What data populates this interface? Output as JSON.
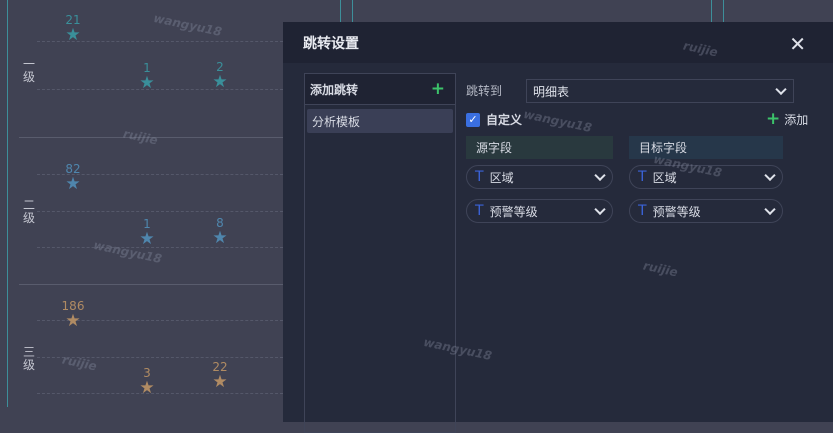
{
  "chart": {
    "rows": [
      {
        "label": "一级",
        "color": "#3a8f9a",
        "points": [
          {
            "value": "21"
          },
          {
            "value": "1"
          },
          {
            "value": "2"
          }
        ]
      },
      {
        "label": "二级",
        "color": "#4f86ad",
        "points": [
          {
            "value": "82"
          },
          {
            "value": "1"
          },
          {
            "value": "8"
          }
        ]
      },
      {
        "label": "三级",
        "color": "#b08b63",
        "points": [
          {
            "value": "186"
          },
          {
            "value": "3"
          },
          {
            "value": "22"
          }
        ]
      }
    ]
  },
  "watermarks": [
    "wangyu18",
    "ruijie"
  ],
  "modal": {
    "title": "跳转设置",
    "left": {
      "header": "添加跳转",
      "items": [
        "分析模板"
      ]
    },
    "jump_to_label": "跳转到",
    "jump_to_value": "明细表",
    "custom_label": "自定义",
    "add_label": "添加",
    "source_header": "源字段",
    "target_header": "目标字段",
    "mappings": [
      {
        "source": "区域",
        "target": "区域"
      },
      {
        "source": "预警等级",
        "target": "预警等级"
      }
    ]
  }
}
